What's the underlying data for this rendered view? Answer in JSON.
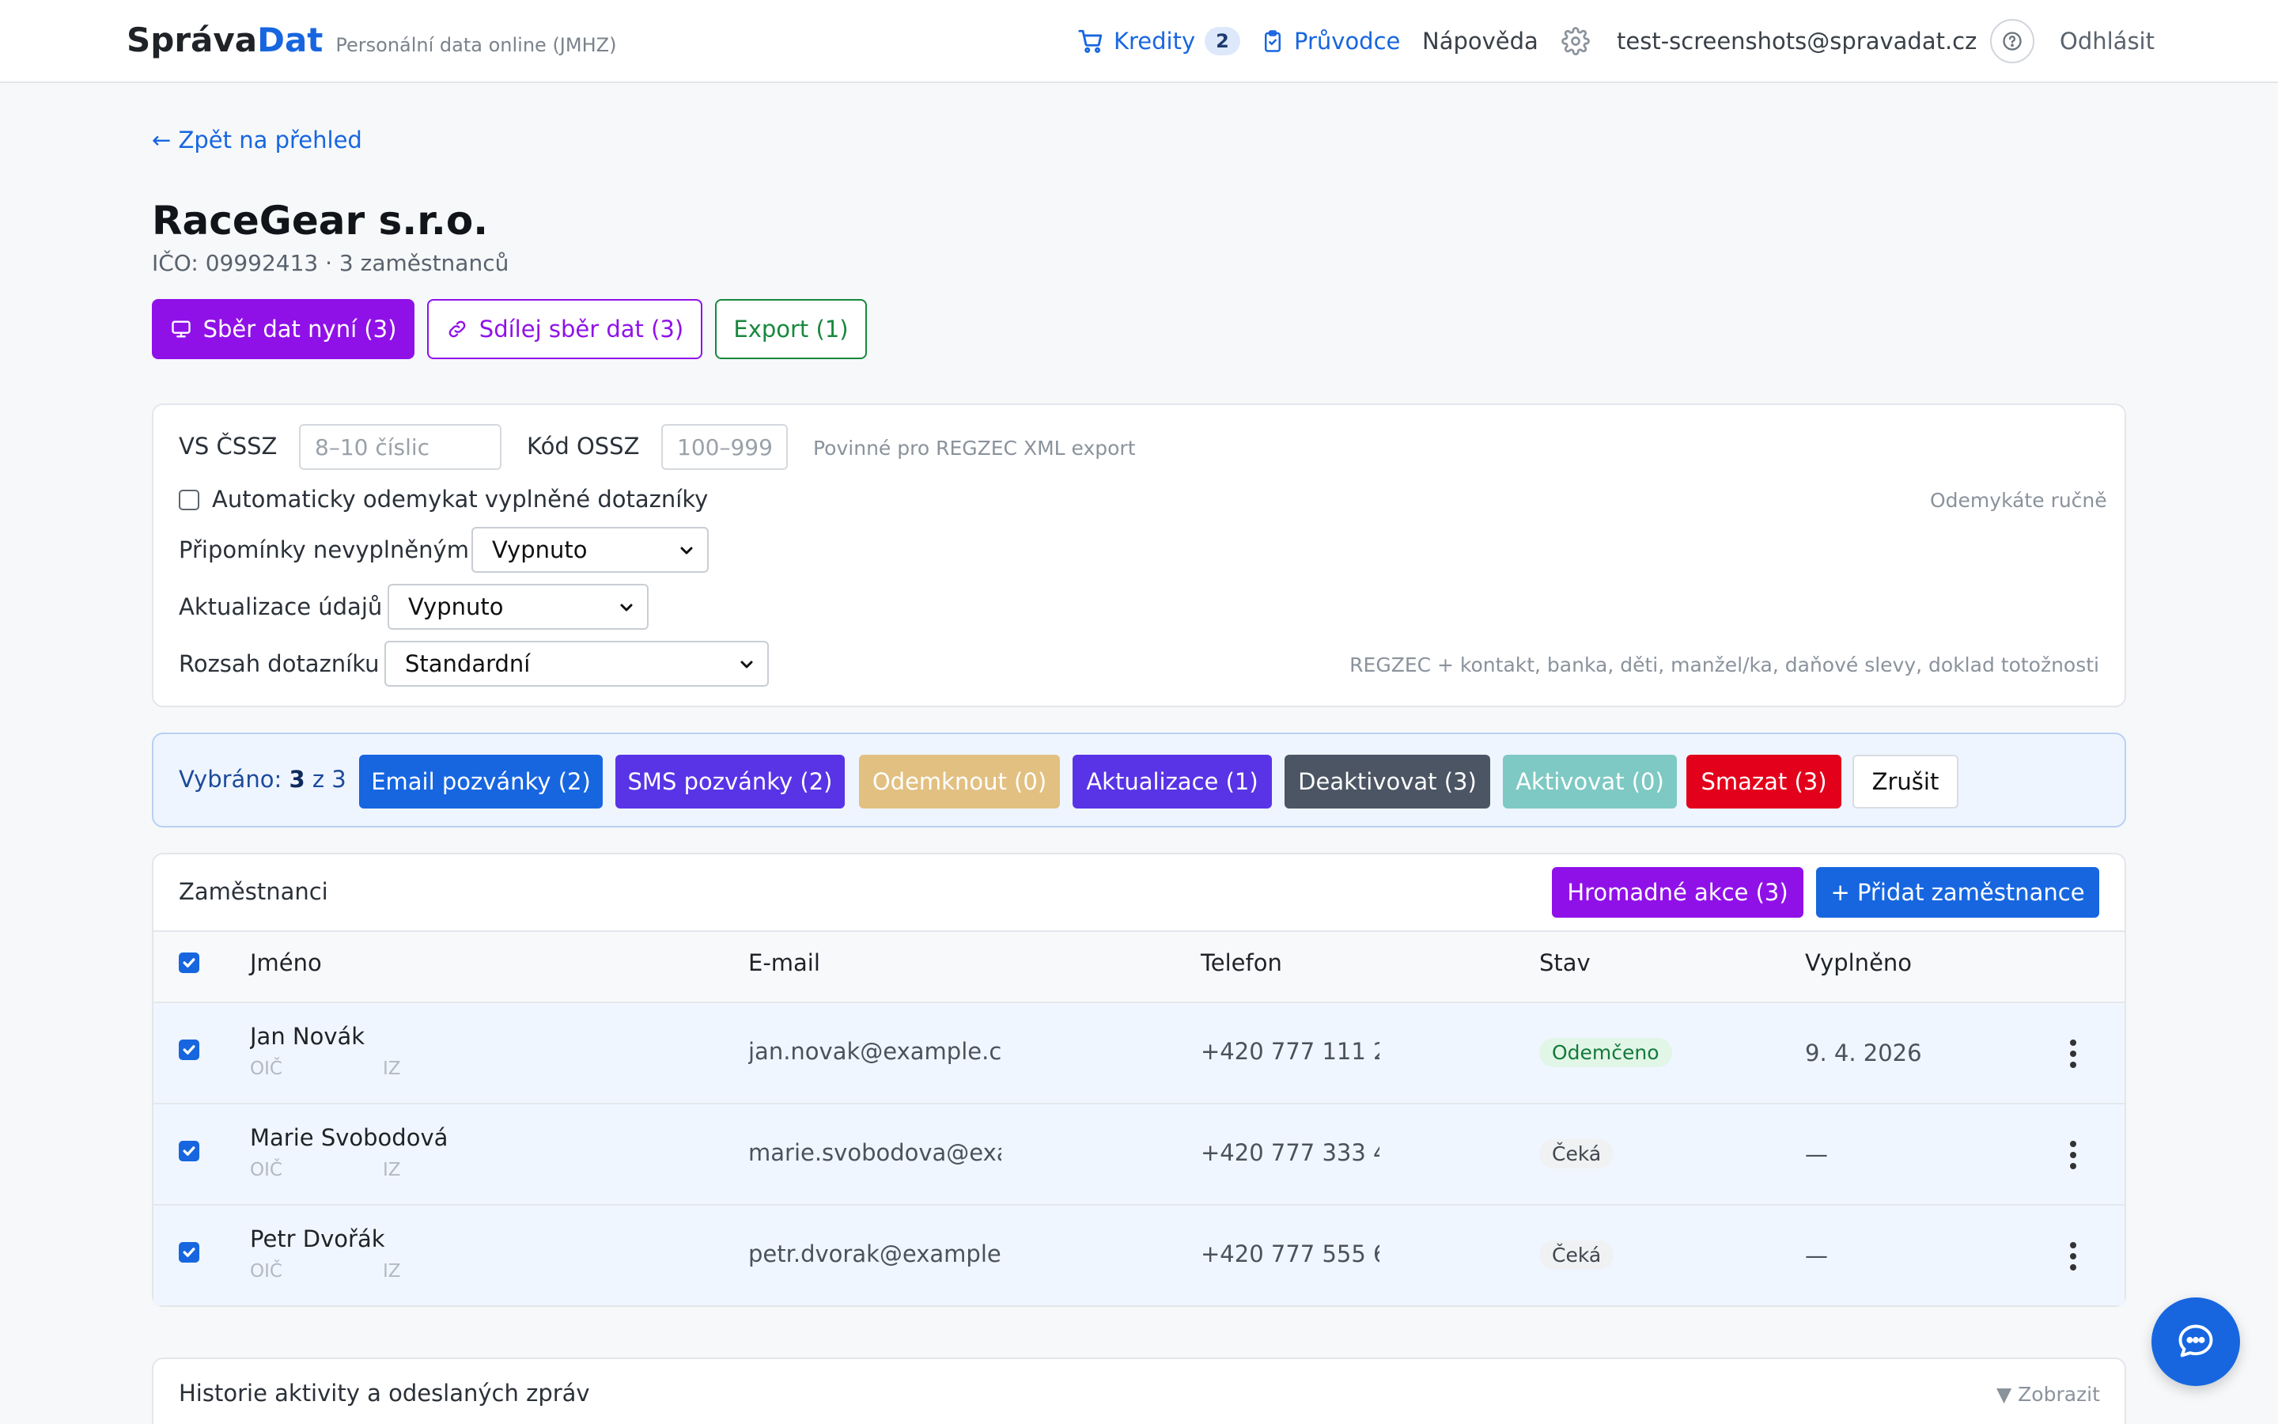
{
  "header": {
    "brand_part1": "Správa",
    "brand_part2": "Dat",
    "tagline": "Personální data online (JMHZ)",
    "credits_label": "Kredity",
    "credits_count": "2",
    "guide_label": "Průvodce",
    "help_label": "Nápověda",
    "user_email": "test-screenshots@spravadat.cz",
    "logout_label": "Odhlásit"
  },
  "back_link": "← Zpět na přehled",
  "company": {
    "name": "RaceGear s.r.o.",
    "meta": "IČO: 09992413 · 3 zaměstnanců"
  },
  "actions": {
    "collect_now": "Sběr dat nyní (3)",
    "share_collect": "Sdílej sběr dat (3)",
    "export": "Export (1)"
  },
  "settings": {
    "vs_label": "VS ČSSZ",
    "vs_placeholder": "8–10 číslic",
    "ossz_label": "Kód OSSZ",
    "ossz_placeholder": "100–999",
    "required_hint": "Povinné pro REGZEC XML export",
    "auto_unlock_label": "Automaticky odemykat vyplněné dotazníky",
    "auto_unlock_hint": "Odemykáte ručně",
    "reminders_label": "Připomínky nevyplněným",
    "reminders_value": "Vypnuto",
    "updates_label": "Aktualizace údajů",
    "updates_value": "Vypnuto",
    "scope_label": "Rozsah dotazníku",
    "scope_value": "Standardní",
    "scope_hint": "REGZEC + kontakt, banka, děti, manžel/ka, daňové slevy, doklad totožnosti"
  },
  "selection": {
    "prefix": "Vybráno:",
    "count": "3",
    "of": "z 3",
    "email_invites": "Email pozvánky (2)",
    "sms_invites": "SMS pozvánky (2)",
    "unlock": "Odemknout (0)",
    "update": "Aktualizace (1)",
    "deactivate": "Deaktivovat (3)",
    "activate": "Aktivovat (0)",
    "delete": "Smazat (3)",
    "cancel": "Zrušit"
  },
  "employees": {
    "title": "Zaměstnanci",
    "bulk_actions": "Hromadné akce (3)",
    "add_employee": "+ Přidat zaměstnance",
    "columns": [
      "Jméno",
      "E-mail",
      "Telefon",
      "Stav",
      "Vyplněno"
    ],
    "rows": [
      {
        "name": "Jan Novák",
        "oic": "OIČ",
        "iz": "IZ",
        "email": "jan.novak@example.cz",
        "phone": "+420 777 111 2",
        "status": "Odemčeno",
        "filled": "9. 4. 2026"
      },
      {
        "name": "Marie Svobodová",
        "oic": "OIČ",
        "iz": "IZ",
        "email": "marie.svobodova@exa",
        "phone": "+420 777 333 4",
        "status": "Čeká",
        "filled": "—"
      },
      {
        "name": "Petr Dvořák",
        "oic": "OIČ",
        "iz": "IZ",
        "email": "petr.dvorak@example.",
        "phone": "+420 777 555 6",
        "status": "Čeká",
        "filled": "—"
      }
    ]
  },
  "history": {
    "title": "Historie aktivity a odeslaných zpráv",
    "toggle": "▼ Zobrazit"
  },
  "colors": {
    "primary": "#1766e0",
    "purple": "#9011e8",
    "green": "#18883d",
    "indigo": "#5834e6",
    "tan": "#e2c081",
    "slate": "#4b5563",
    "teal": "#7ec9c3",
    "red": "#e3001b"
  }
}
